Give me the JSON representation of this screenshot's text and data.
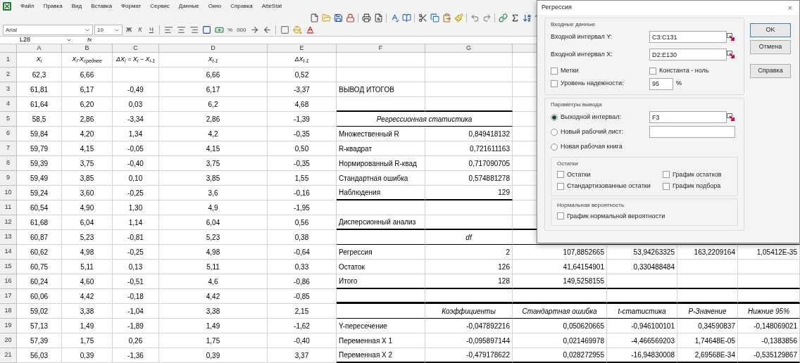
{
  "menu": [
    "Файл",
    "Правка",
    "Вид",
    "Вставка",
    "Формат",
    "Сервис",
    "Данные",
    "Окно",
    "Справка",
    "AtteStat"
  ],
  "format_bar": {
    "font": "Arial",
    "size": "10",
    "style_buttons": [
      "Ж",
      "К",
      "Ч"
    ],
    "number_buttons": [
      "%",
      "000"
    ]
  },
  "formula_bar": {
    "name_box": "L28",
    "fx": "fx"
  },
  "sheet": {
    "columns": [
      "A",
      "B",
      "C",
      "D",
      "E",
      "F",
      "G"
    ],
    "rows": [
      {
        "number": "1",
        "cells": {
          "A": "X$_{i}$",
          "B": "X$_{i}$-X$_{среднее}$",
          "C": "ΔX$_{i}$ = X$_{i}$ − X$_{i-1}$",
          "D": "X$_{t-1}$",
          "E": "ΔX$_{t-1}$"
        }
      },
      {
        "number": "2",
        "cells": {
          "A": "62,3",
          "B": "6,66",
          "D": "6,66",
          "E": "0,52"
        }
      },
      {
        "number": "3",
        "cells": {
          "A": "61,81",
          "B": "6,17",
          "C": "-0,49",
          "D": "6,17",
          "E": "-3,37",
          "F": "ВЫВОД ИТОГОВ"
        }
      },
      {
        "number": "4",
        "cells": {
          "A": "61,64",
          "B": "6,20",
          "C": "0,03",
          "D": "6,2",
          "E": "4,68"
        }
      },
      {
        "number": "5",
        "cells": {
          "A": "58,5",
          "B": "2,86",
          "C": "-3,34",
          "D": "2,86",
          "E": "-1,39",
          "F": {
            "text": "Регрессионная статистика",
            "kind": "merged"
          }
        }
      },
      {
        "number": "6",
        "cells": {
          "A": "59,84",
          "B": "4,20",
          "C": "1,34",
          "D": "4,2",
          "E": "-0,35",
          "F": "Множественный R",
          "G": "0,849418132"
        }
      },
      {
        "number": "7",
        "cells": {
          "A": "59,79",
          "B": "4,15",
          "C": "-0,05",
          "D": "4,15",
          "E": "0,50",
          "F": "R-квадрат",
          "G": "0,721611163"
        }
      },
      {
        "number": "8",
        "cells": {
          "A": "59,39",
          "B": "3,75",
          "C": "-0,40",
          "D": "3,75",
          "E": "-0,35",
          "F": "Нормированный R-квад",
          "G": "0,717090705"
        }
      },
      {
        "number": "9",
        "cells": {
          "A": "59,49",
          "B": "3,85",
          "C": "0,10",
          "D": "3,85",
          "E": "1,55",
          "F": "Стандартная ошибка",
          "G": "0,574881278"
        }
      },
      {
        "number": "10",
        "cells": {
          "A": "59,24",
          "B": "3,60",
          "C": "-0,25",
          "D": "3,6",
          "E": "-0,16",
          "F": "Наблюдения",
          "G": "129"
        }
      },
      {
        "number": "11",
        "cells": {
          "A": "60,54",
          "B": "4,90",
          "C": "1,30",
          "D": "4,9",
          "E": "-1,95"
        }
      },
      {
        "number": "12",
        "cells": {
          "A": "61,68",
          "B": "6,04",
          "C": "1,14",
          "D": "6,04",
          "E": "0,56",
          "F": "Дисперсионный анализ"
        }
      },
      {
        "number": "13",
        "cells": {
          "A": "60,87",
          "B": "5,23",
          "C": "-0,81",
          "D": "5,23",
          "E": "0,38",
          "G": {
            "text": "df",
            "kind": "header"
          }
        }
      },
      {
        "number": "14",
        "cells": {
          "A": "60,62",
          "B": "4,98",
          "C": "-0,25",
          "D": "4,98",
          "E": "-0,64",
          "F": "Регрессия",
          "G": "2",
          "H": "107,8852665",
          "I": "53,94263325",
          "J": "163,2209164",
          "K": "1,05412E-35"
        }
      },
      {
        "number": "15",
        "cells": {
          "A": "60,75",
          "B": "5,11",
          "C": "0,13",
          "D": "5,11",
          "E": "0,33",
          "F": "Остаток",
          "G": "126",
          "H": "41,64154901",
          "I": "0,330488484"
        }
      },
      {
        "number": "16",
        "cells": {
          "A": "60,24",
          "B": "4,60",
          "C": "-0,51",
          "D": "4,6",
          "E": "-0,86",
          "F": "Итого",
          "G": "128",
          "H": "149,5258155"
        }
      },
      {
        "number": "17",
        "cells": {
          "A": "60,06",
          "B": "4,42",
          "C": "-0,18",
          "D": "4,42",
          "E": "-0,85"
        }
      },
      {
        "number": "18",
        "cells": {
          "A": "59,02",
          "B": "3,38",
          "C": "-1,04",
          "D": "3,38",
          "E": "2,15",
          "G": {
            "text": "Коэффициенты",
            "kind": "header"
          },
          "H": {
            "text": "Стандартная ошибка",
            "kind": "header"
          },
          "I": {
            "text": "t-статистика",
            "kind": "header"
          },
          "J": {
            "text": "P-Значение",
            "kind": "header"
          },
          "K": {
            "text": "Нижние 95%",
            "kind": "header"
          }
        }
      },
      {
        "number": "19",
        "cells": {
          "A": "57,13",
          "B": "1,49",
          "C": "-1,89",
          "D": "1,49",
          "E": "-1,62",
          "F": "Y-пересечение",
          "G": "-0,047892216",
          "H": "0,050620665",
          "I": "-0,946100101",
          "J": "0,34590837",
          "K": "-0,148069021"
        }
      },
      {
        "number": "20",
        "cells": {
          "A": "57,39",
          "B": "1,75",
          "C": "0,26",
          "D": "1,75",
          "E": "-0,40",
          "F": "Переменная X 1",
          "G": "-0,095897144",
          "H": "0,021469978",
          "I": "-4,466569203",
          "J": "1,74648E-05",
          "K": "-0,1383856"
        }
      },
      {
        "number": "21",
        "cells": {
          "A": "56,03",
          "B": "0,39",
          "C": "-1,36",
          "D": "0,39",
          "E": "3,37",
          "F": "Переменная X 2",
          "G": "-0,479178622",
          "H": "0,028272955",
          "I": "-16,94830008",
          "J": "2,69568E-34",
          "K": "-0,535129867"
        }
      }
    ]
  },
  "dialog": {
    "title": "Регрессия",
    "close": "×",
    "input_group": {
      "title": "Входные данные",
      "ranges": [
        {
          "label": "Входной интервал Y:",
          "value": "C3:C131"
        },
        {
          "label": "Входной интервал X:",
          "value": "D2:E130"
        }
      ],
      "options": [
        {
          "label": "Метки",
          "checked": false
        },
        {
          "label": "Константа - ноль",
          "checked": false
        }
      ],
      "confidence": {
        "label": "Уровень надежности:",
        "checked": false,
        "value": "95",
        "unit": "%"
      }
    },
    "output_group": {
      "title": "Параметры вывода",
      "destinations": [
        {
          "label": "Выходной интервал:",
          "selected": true,
          "kind": "range",
          "value": "F3"
        },
        {
          "label": "Новый рабочий лист:",
          "selected": false,
          "kind": "field"
        },
        {
          "label": "Новая рабочая книга",
          "selected": false,
          "kind": "plain"
        }
      ],
      "residuals": {
        "title": "Остатки",
        "options": [
          {
            "label": "Остатки",
            "checked": false
          },
          {
            "label": "График остатков",
            "checked": false
          },
          {
            "label": "Стандартизованные остатки",
            "checked": false
          },
          {
            "label": "График подбора",
            "checked": false
          }
        ]
      },
      "normal": {
        "title": "Нормальная вероятность",
        "options": [
          {
            "label": "График нормальной вероятности",
            "checked": false
          }
        ]
      }
    },
    "buttons": [
      "OK",
      "Отмена",
      "Справка"
    ]
  }
}
